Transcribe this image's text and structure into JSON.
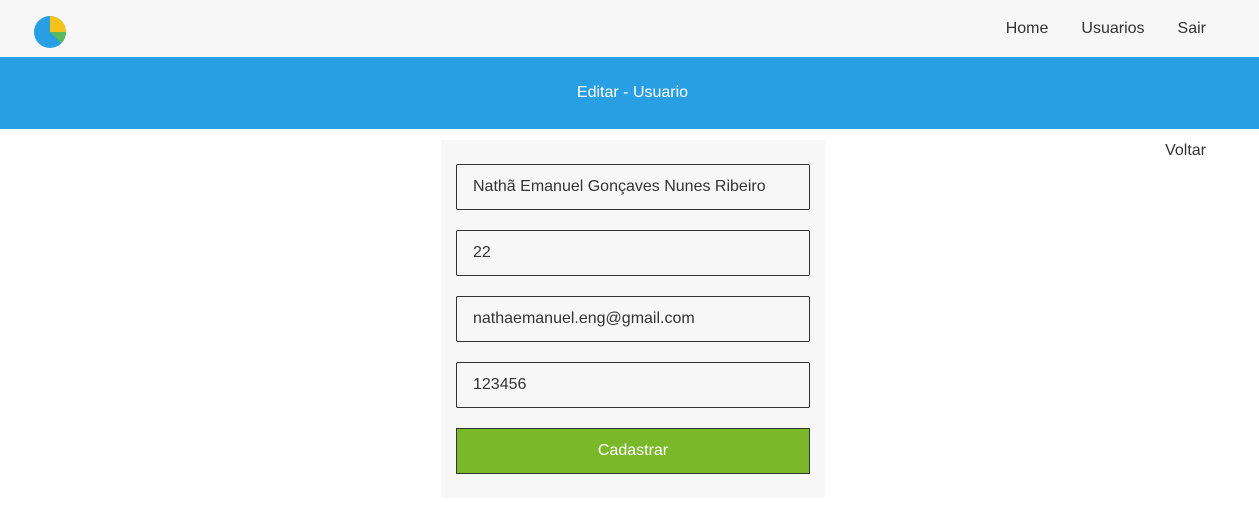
{
  "navbar": {
    "logo_icon": "pie-chart-icon",
    "links": [
      {
        "label": "Home"
      },
      {
        "label": "Usuarios"
      },
      {
        "label": "Sair"
      }
    ]
  },
  "banner": {
    "title": "Editar - Usuario",
    "color": "#299fe3"
  },
  "back_link": {
    "label": "Voltar"
  },
  "form": {
    "fields": [
      {
        "value": "Nathã Emanuel Gonçaves Nunes Ribeiro"
      },
      {
        "value": "22"
      },
      {
        "value": "nathaemanuel.eng@gmail.com"
      },
      {
        "value": "123456"
      }
    ],
    "submit_label": "Cadastrar",
    "submit_color": "#7ab829"
  }
}
